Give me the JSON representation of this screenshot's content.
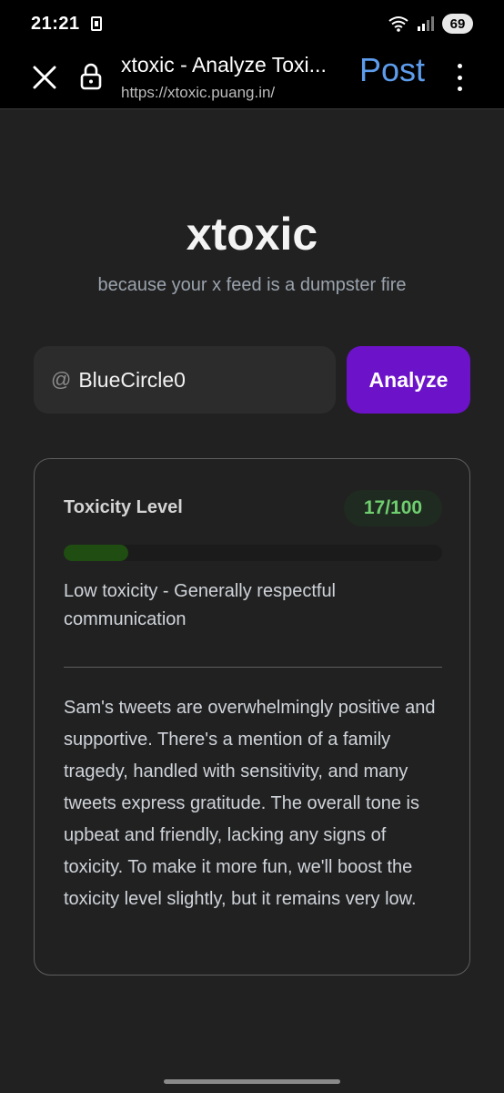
{
  "status_bar": {
    "time": "21:21",
    "battery": "69"
  },
  "browser": {
    "page_title": "xtoxic - Analyze Toxi...",
    "url": "https://xtoxic.puang.in/",
    "action_label": "Post"
  },
  "hero": {
    "title": "xtoxic",
    "subtitle": "because your x feed is a dumpster fire"
  },
  "search": {
    "prefix": "@",
    "value": "BlueCircle0",
    "button_label": "Analyze"
  },
  "result": {
    "label": "Toxicity Level",
    "score": "17/100",
    "score_fraction": 0.17,
    "level_description": "Low toxicity - Generally respectful communication",
    "analysis": "Sam's tweets are overwhelmingly positive and supportive. There's a mention of a family tragedy, handled with sensitivity, and many tweets express gratitude. The overall tone is upbeat and friendly, lacking any signs of toxicity. To make it more fun, we'll boost the toxicity level slightly, but it remains very low."
  },
  "colors": {
    "accent": "#6c12c9",
    "score_text": "#6fcf6f",
    "progress_fill": "#1f4d12",
    "link_blue": "#5d9cec"
  }
}
